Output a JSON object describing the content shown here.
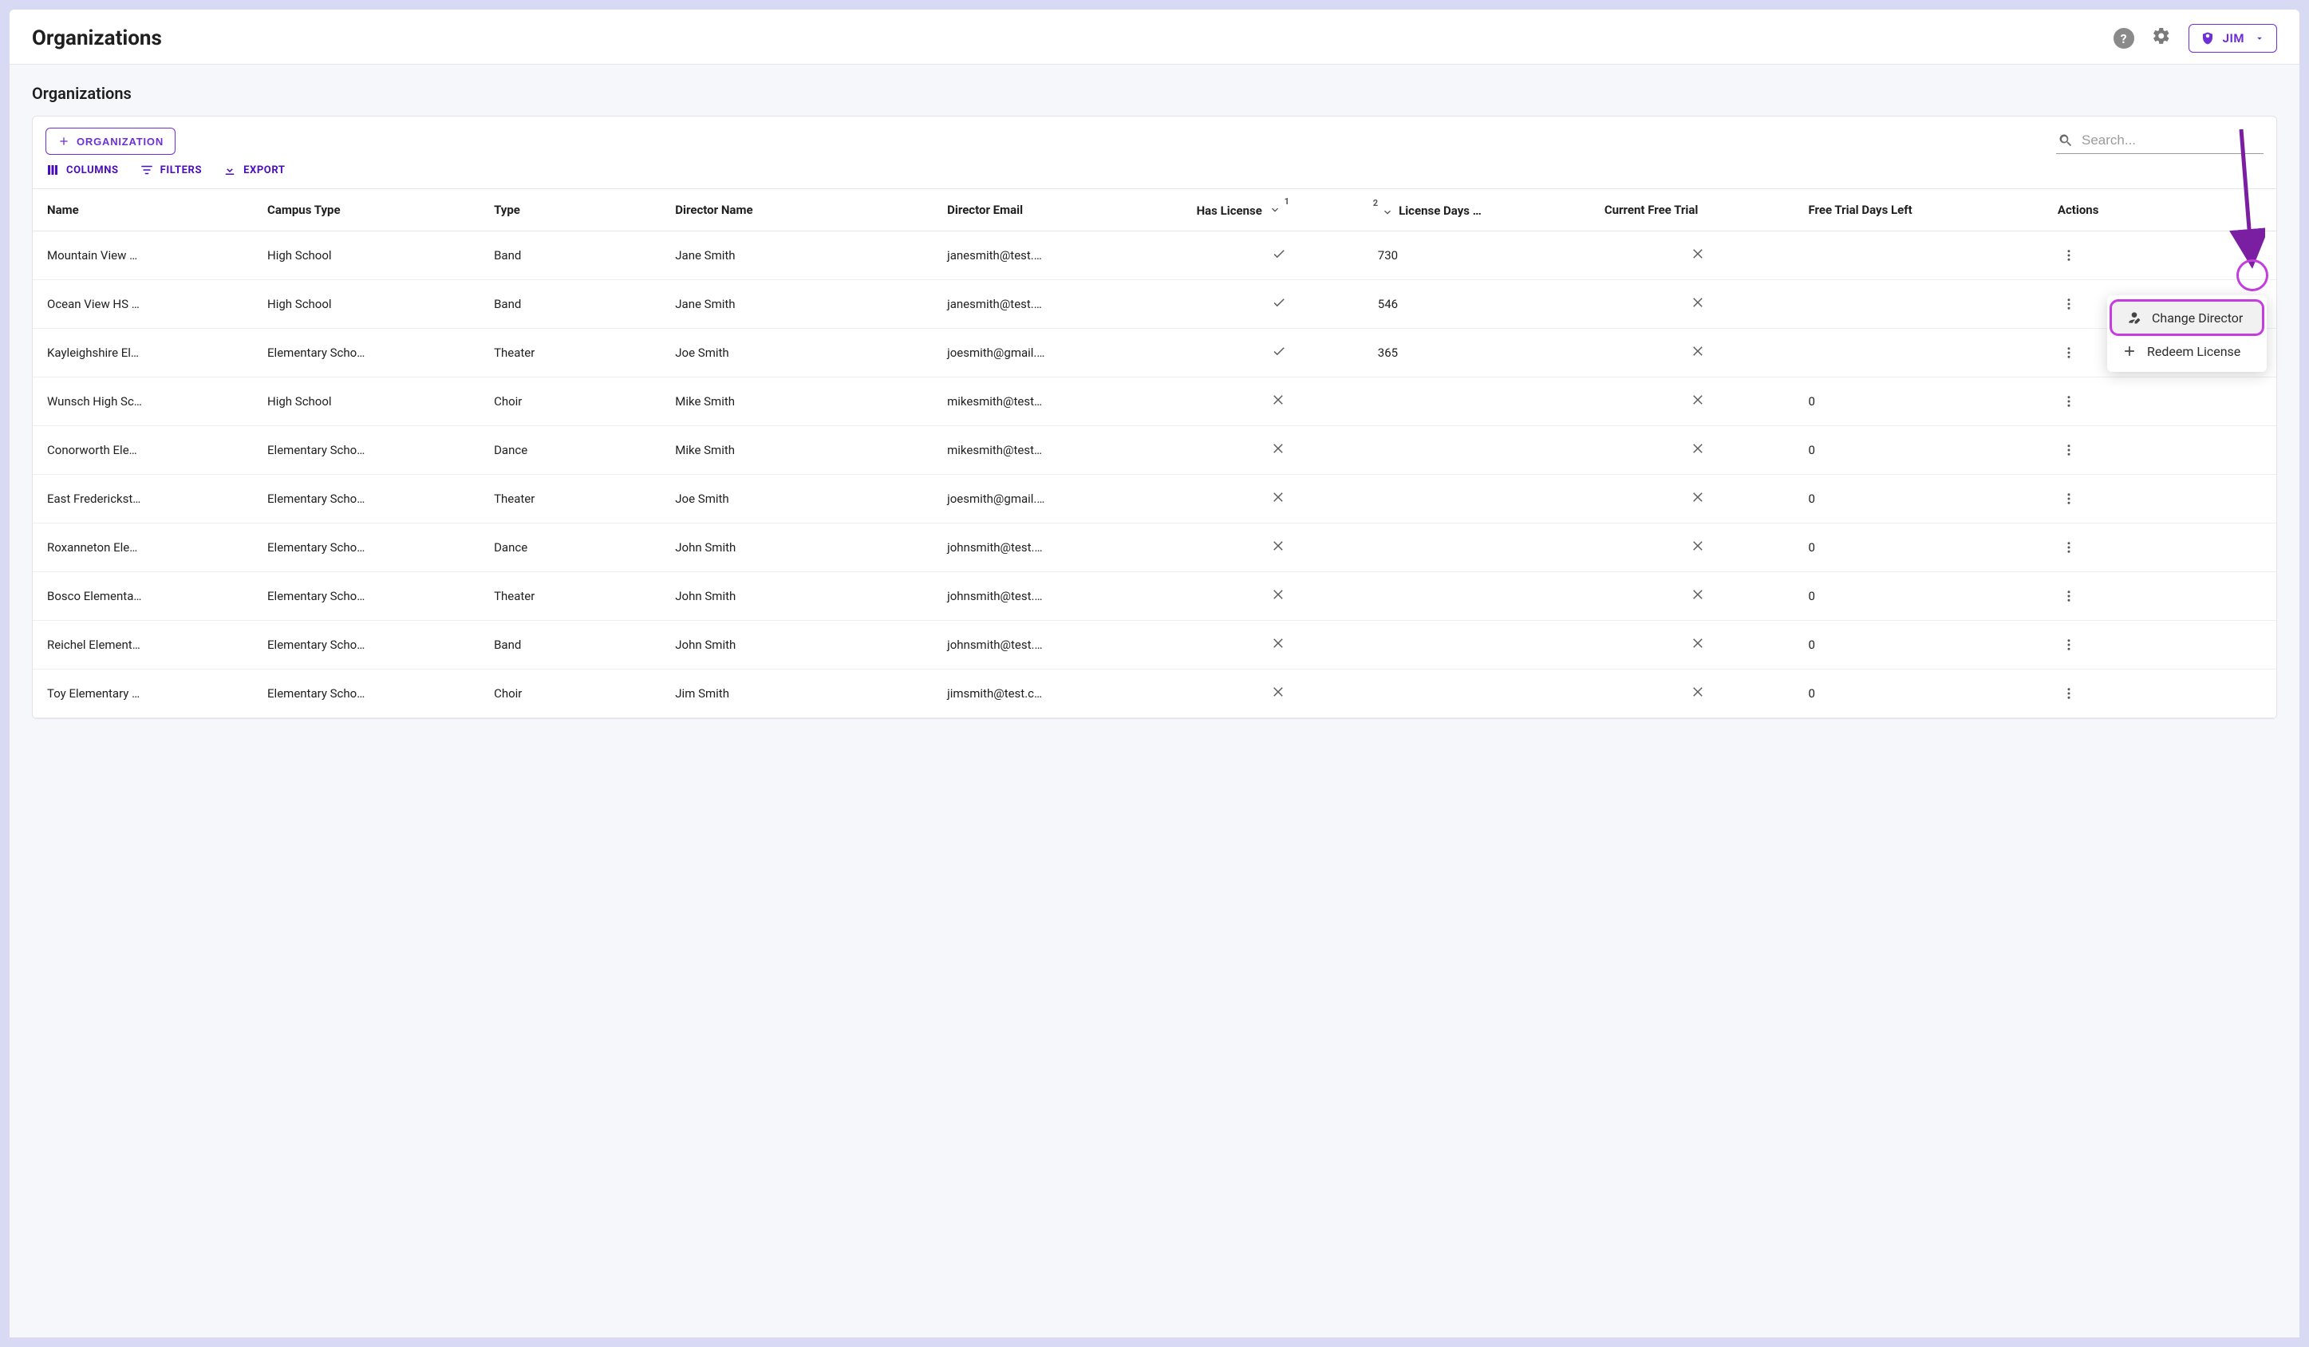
{
  "header": {
    "title": "Organizations",
    "user_name": "JIM"
  },
  "section": {
    "title": "Organizations"
  },
  "toolbar": {
    "add_label": "ORGANIZATION",
    "columns_label": "COLUMNS",
    "filters_label": "FILTERS",
    "export_label": "EXPORT"
  },
  "search": {
    "placeholder": "Search..."
  },
  "table": {
    "sort": [
      {
        "col": "has_license",
        "dir": "desc",
        "priority": 1
      },
      {
        "col": "license_days",
        "dir": "desc",
        "priority": 2
      }
    ],
    "columns": {
      "name": "Name",
      "campus_type": "Campus Type",
      "type": "Type",
      "director_name": "Director Name",
      "director_email": "Director Email",
      "has_license": "Has License",
      "license_days": "License Days …",
      "current_free_trial": "Current Free Trial",
      "free_trial_days_left": "Free Trial Days Left",
      "actions": "Actions"
    },
    "rows": [
      {
        "name": "Mountain View …",
        "campus_type": "High School",
        "type": "Band",
        "director_name": "Jane Smith",
        "director_email": "janesmith@test.…",
        "has_license": true,
        "license_days": 730,
        "current_free_trial": false,
        "free_trial_days_left": ""
      },
      {
        "name": "Ocean View HS …",
        "campus_type": "High School",
        "type": "Band",
        "director_name": "Jane Smith",
        "director_email": "janesmith@test.…",
        "has_license": true,
        "license_days": 546,
        "current_free_trial": false,
        "free_trial_days_left": ""
      },
      {
        "name": "Kayleighshire El…",
        "campus_type": "Elementary Scho…",
        "type": "Theater",
        "director_name": "Joe Smith",
        "director_email": "joesmith@gmail.…",
        "has_license": true,
        "license_days": 365,
        "current_free_trial": false,
        "free_trial_days_left": ""
      },
      {
        "name": "Wunsch High Sc…",
        "campus_type": "High School",
        "type": "Choir",
        "director_name": "Mike Smith",
        "director_email": "mikesmith@test…",
        "has_license": false,
        "license_days": "",
        "current_free_trial": false,
        "free_trial_days_left": 0
      },
      {
        "name": "Conorworth Ele…",
        "campus_type": "Elementary Scho…",
        "type": "Dance",
        "director_name": "Mike Smith",
        "director_email": "mikesmith@test…",
        "has_license": false,
        "license_days": "",
        "current_free_trial": false,
        "free_trial_days_left": 0
      },
      {
        "name": "East Frederickst…",
        "campus_type": "Elementary Scho…",
        "type": "Theater",
        "director_name": "Joe Smith",
        "director_email": "joesmith@gmail.…",
        "has_license": false,
        "license_days": "",
        "current_free_trial": false,
        "free_trial_days_left": 0
      },
      {
        "name": "Roxanneton Ele…",
        "campus_type": "Elementary Scho…",
        "type": "Dance",
        "director_name": "John Smith",
        "director_email": "johnsmith@test.…",
        "has_license": false,
        "license_days": "",
        "current_free_trial": false,
        "free_trial_days_left": 0
      },
      {
        "name": "Bosco Elementa…",
        "campus_type": "Elementary Scho…",
        "type": "Theater",
        "director_name": "John Smith",
        "director_email": "johnsmith@test.…",
        "has_license": false,
        "license_days": "",
        "current_free_trial": false,
        "free_trial_days_left": 0
      },
      {
        "name": "Reichel Element…",
        "campus_type": "Elementary Scho…",
        "type": "Band",
        "director_name": "John Smith",
        "director_email": "johnsmith@test.…",
        "has_license": false,
        "license_days": "",
        "current_free_trial": false,
        "free_trial_days_left": 0
      },
      {
        "name": "Toy Elementary …",
        "campus_type": "Elementary Scho…",
        "type": "Choir",
        "director_name": "Jim Smith",
        "director_email": "jimsmith@test.c…",
        "has_license": false,
        "license_days": "",
        "current_free_trial": false,
        "free_trial_days_left": 0
      }
    ]
  },
  "context_menu": {
    "change_director": "Change Director",
    "redeem_license": "Redeem License"
  }
}
